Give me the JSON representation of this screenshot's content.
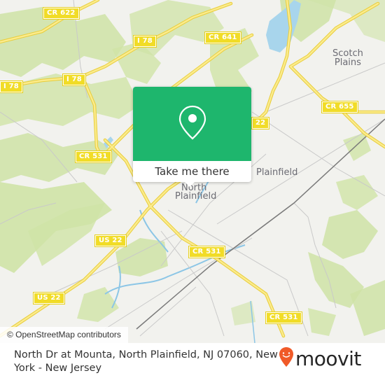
{
  "map": {
    "road_labels": [
      {
        "id": "cr622",
        "text": "CR 622"
      },
      {
        "id": "i78-a",
        "text": "I 78"
      },
      {
        "id": "i78-b",
        "text": "I 78"
      },
      {
        "id": "i78-c",
        "text": "I 78"
      },
      {
        "id": "cr641",
        "text": "CR 641"
      },
      {
        "id": "cr531-a",
        "text": "CR 531"
      },
      {
        "id": "cr655",
        "text": "CR 655"
      },
      {
        "id": "us22-a",
        "text": "22"
      },
      {
        "id": "us22-b",
        "text": "US 22"
      },
      {
        "id": "us22-c",
        "text": "US 22"
      },
      {
        "id": "cr531-b",
        "text": "CR 531"
      },
      {
        "id": "cr531-c",
        "text": "CR 531"
      }
    ],
    "place_labels": {
      "scotch_plains": "Scotch\nPlains",
      "plainfield": "Plainfield",
      "north_plainfield_1": "North",
      "north_plainfield_2": "Plainfield"
    },
    "colors": {
      "background": "#f2f2ee",
      "park": "#cfe3a6",
      "water": "#a8d5ec",
      "road_major": "#f5dd5a",
      "road_minor": "#c9c9c9",
      "rail": "#7a7a7a"
    }
  },
  "popup": {
    "button_label": "Take me there",
    "icon": "map-pin-icon",
    "accent_color": "#1eb66d"
  },
  "attribution": "© OpenStreetMap contributors",
  "footer": {
    "address": "North Dr at Mounta, North Plainfield, NJ 07060, New York - New Jersey",
    "brand": "moovit",
    "brand_color": "#f05a28"
  }
}
